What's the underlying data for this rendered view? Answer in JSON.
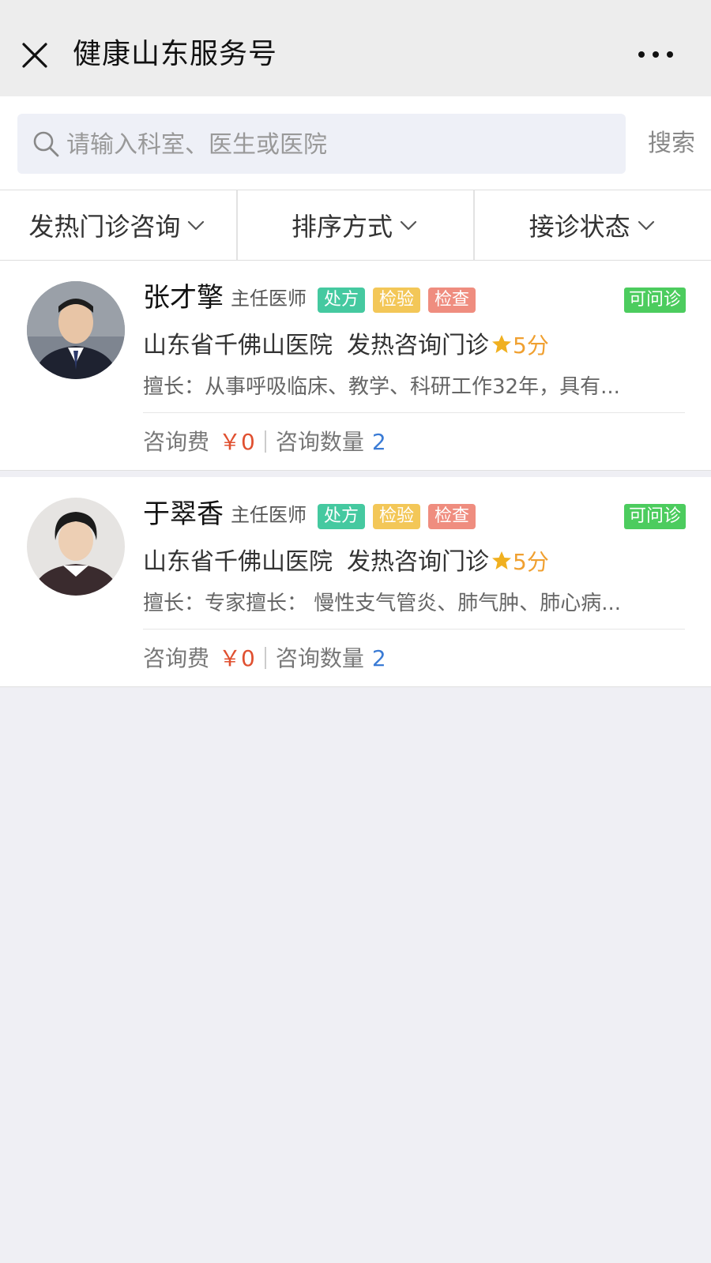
{
  "header": {
    "title": "健康山东服务号",
    "close_icon": "close-icon",
    "more_icon": "more-icon"
  },
  "search": {
    "placeholder": "请输入科室、医生或医院",
    "value": "",
    "button": "搜索"
  },
  "filters": [
    {
      "label": "发热门诊咨询"
    },
    {
      "label": "排序方式"
    },
    {
      "label": "接诊状态"
    }
  ],
  "doctors": [
    {
      "name": "张才擎",
      "title": "主任医师",
      "tags": [
        "处方",
        "检验",
        "检查"
      ],
      "status": "可问诊",
      "hospital": "山东省千佛山医院",
      "department": "发热咨询门诊",
      "rating": "5分",
      "specialty": "擅长：从事呼吸临床、教学、科研工作32年，具有...",
      "fee_label": "咨询费",
      "fee_value": "￥0",
      "count_label": "咨询数量",
      "count_value": "2"
    },
    {
      "name": "于翠香",
      "title": "主任医师",
      "tags": [
        "处方",
        "检验",
        "检查"
      ],
      "status": "可问诊",
      "hospital": "山东省千佛山医院",
      "department": "发热咨询门诊",
      "rating": "5分",
      "specialty": "擅长：专家擅长： 慢性支气管炎、肺气肿、肺心病...",
      "fee_label": "咨询费",
      "fee_value": "￥0",
      "count_label": "咨询数量",
      "count_value": "2"
    }
  ],
  "colors": {
    "tag_rx": "#45c9a0",
    "tag_lab": "#f3c758",
    "tag_exam": "#ef8d7f",
    "status": "#4ccc5e",
    "fee": "#e05030",
    "count": "#3a7bd5",
    "rating": "#f0a030"
  }
}
